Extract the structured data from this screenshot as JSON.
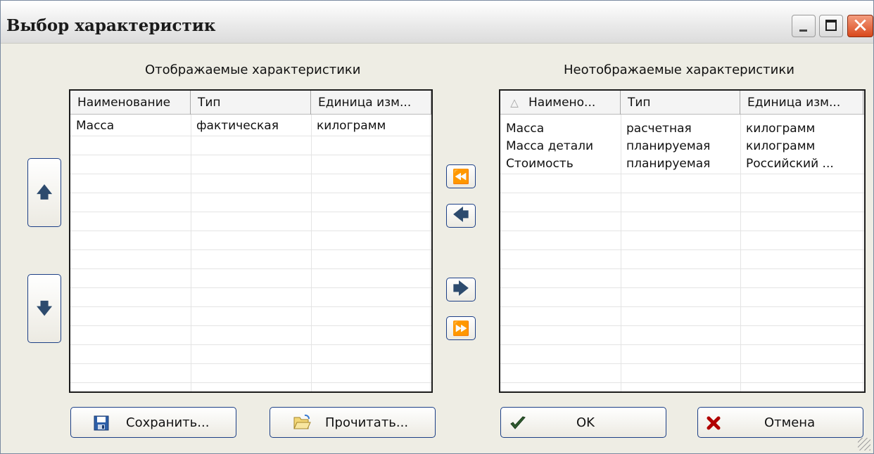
{
  "window": {
    "title": "Выбор характеристик"
  },
  "titlebar": {
    "close_glyph": "✕"
  },
  "left_panel": {
    "caption": "Отображаемые характеристики",
    "columns": [
      "Наименование",
      "Тип",
      "Единица изм..."
    ],
    "rows": [
      [
        "Масса",
        "фактическая",
        "килограмм"
      ]
    ],
    "up_glyph": "🡅",
    "down_glyph": "🡇"
  },
  "right_panel": {
    "caption": "Неотображаемые характеристики",
    "columns": [
      "Наимено...",
      "Тип",
      "Единица изм..."
    ],
    "sort_glyph": "△",
    "rows": [
      [
        "Масса",
        "расчетная",
        "килограмм"
      ],
      [
        "Масса детали",
        "планируемая",
        "килограмм"
      ],
      [
        "Стоимость",
        "планируемая",
        "Российский ..."
      ]
    ]
  },
  "transfer": {
    "all_left_glyph": "⏪",
    "one_left_glyph": "🡄",
    "one_right_glyph": "🡆",
    "all_right_glyph": "⏩"
  },
  "footer": {
    "save_label": "Сохранить...",
    "read_label": "Прочитать...",
    "ok_label": "OK",
    "cancel_label": "Отмена"
  },
  "colors": {
    "button_border": "#1c3f86",
    "ok_check": "#2f5d2f",
    "cancel_x": "#b10000"
  },
  "icons": [
    "floppy-disk-icon",
    "open-folder-icon",
    "checkmark-icon",
    "cross-icon"
  ]
}
